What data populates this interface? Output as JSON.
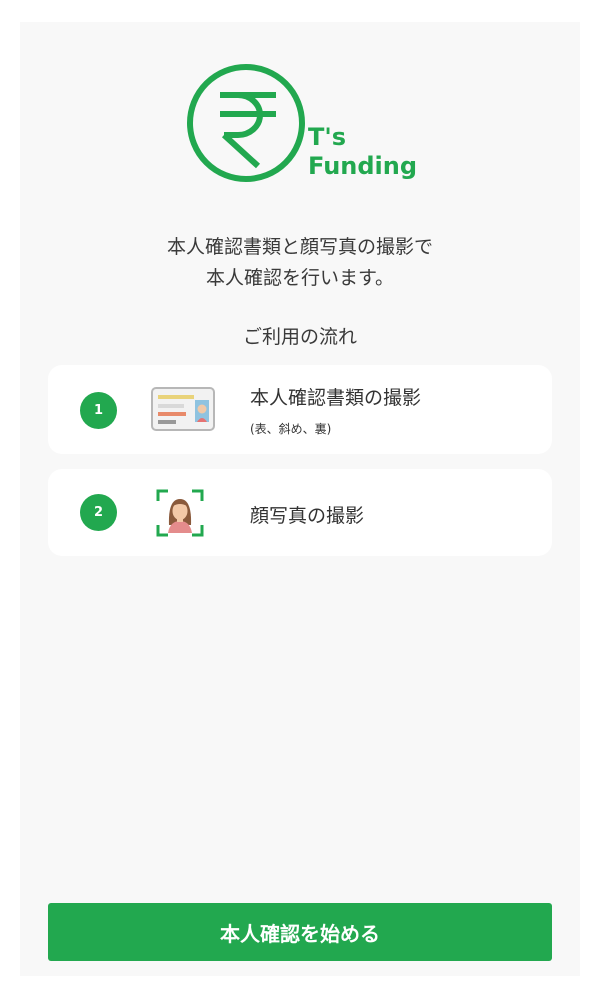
{
  "brand": {
    "logo_icon": "rupee-circle-icon",
    "name_line1": "T's",
    "name_line2": "Funding",
    "color": "#22a84f"
  },
  "intro": {
    "line1": "本人確認書類と顔写真の撮影で",
    "line2": "本人確認を行います。"
  },
  "flow": {
    "title": "ご利用の流れ",
    "steps": [
      {
        "number": "1",
        "icon": "id-card-icon",
        "label": "本人確認書類の撮影",
        "sub": "(表、斜め、裏)"
      },
      {
        "number": "2",
        "icon": "face-capture-icon",
        "label": "顔写真の撮影",
        "sub": ""
      }
    ]
  },
  "start_button": {
    "label": "本人確認を始める"
  }
}
